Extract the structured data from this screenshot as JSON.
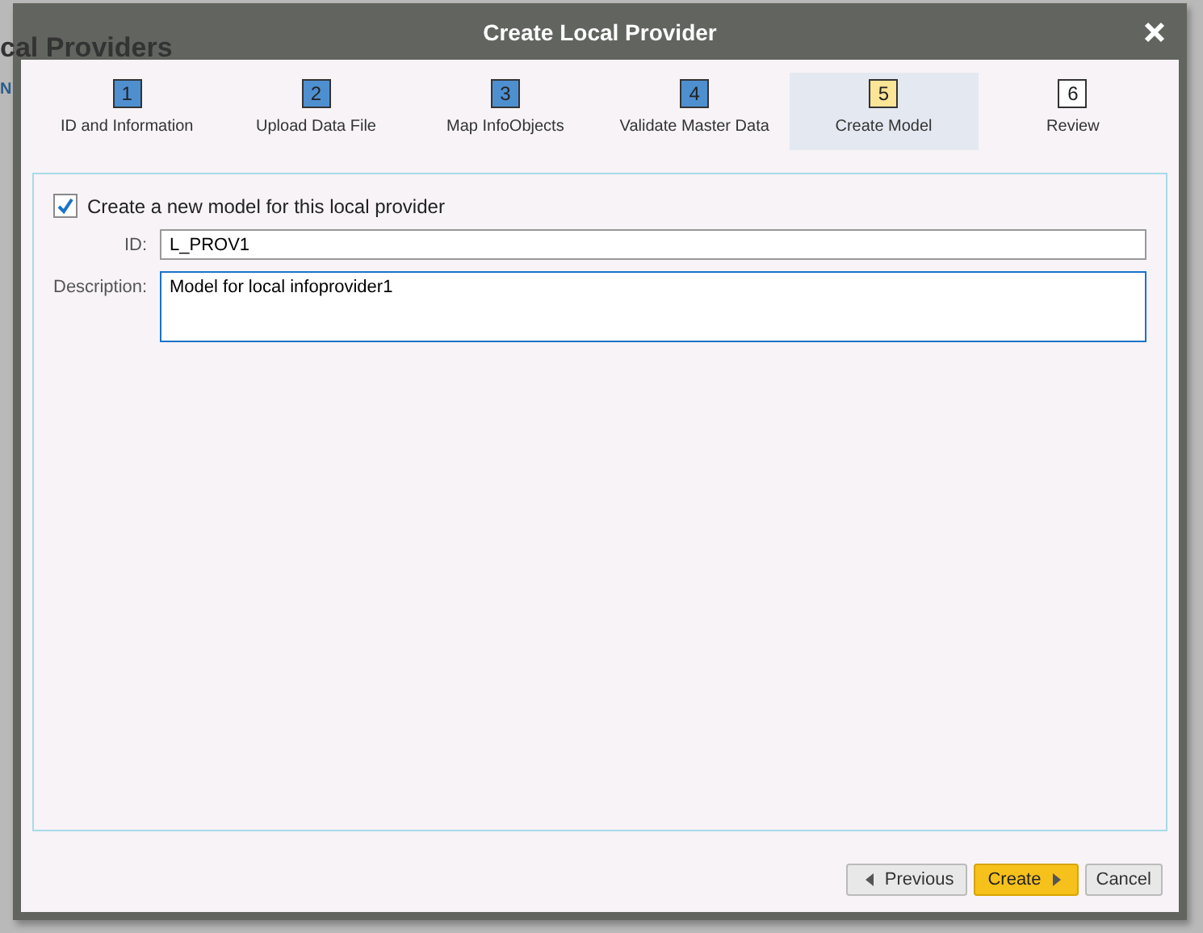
{
  "background_page": {
    "title": "cal Providers",
    "column_header": "N"
  },
  "dialog": {
    "title": "Create Local Provider",
    "steps": [
      {
        "number": "1",
        "label": "ID and Information",
        "completed": true,
        "selected": false
      },
      {
        "number": "2",
        "label": "Upload Data File",
        "completed": true,
        "selected": false
      },
      {
        "number": "3",
        "label": "Map InfoObjects",
        "completed": true,
        "selected": false
      },
      {
        "number": "4",
        "label": "Validate Master Data",
        "completed": true,
        "selected": false
      },
      {
        "number": "5",
        "label": "Create Model",
        "completed": false,
        "selected": true
      },
      {
        "number": "6",
        "label": "Review",
        "completed": false,
        "selected": false
      }
    ],
    "create_model": {
      "label": "Create a new model for this local provider",
      "checked": true
    },
    "id_field": {
      "label": "ID:",
      "value": "L_PROV1"
    },
    "description_field": {
      "label": "Description:",
      "value": "Model for local infoprovider1"
    },
    "buttons": [
      {
        "label": "Previous",
        "kind": "back"
      },
      {
        "label": "Create",
        "kind": "primary"
      },
      {
        "label": "Cancel",
        "kind": "plain"
      }
    ]
  }
}
